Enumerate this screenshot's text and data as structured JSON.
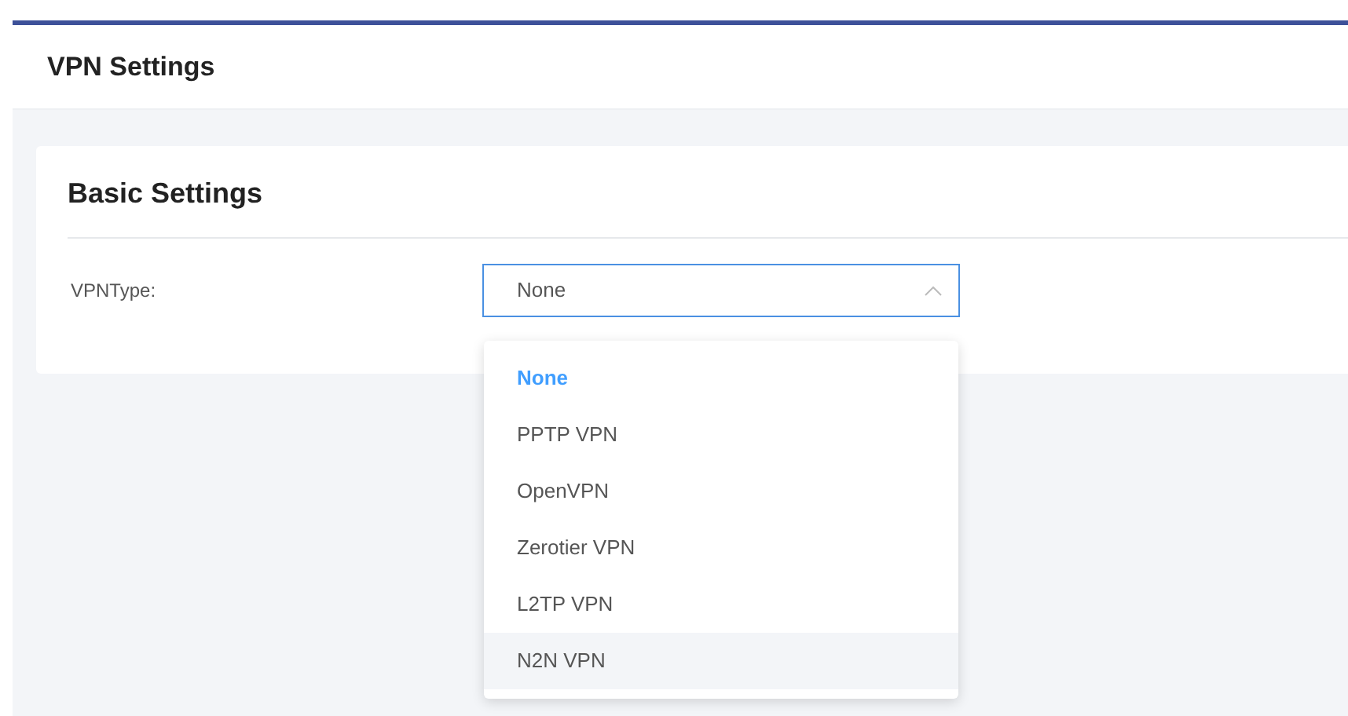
{
  "page_title": "VPN Settings",
  "card": {
    "title": "Basic Settings",
    "field": {
      "label": "VPNType:",
      "value": "None",
      "expanded": true,
      "options": [
        {
          "label": "None",
          "selected": true,
          "hovered": false
        },
        {
          "label": "PPTP VPN",
          "selected": false,
          "hovered": false
        },
        {
          "label": "OpenVPN",
          "selected": false,
          "hovered": false
        },
        {
          "label": "Zerotier VPN",
          "selected": false,
          "hovered": false
        },
        {
          "label": "L2TP VPN",
          "selected": false,
          "hovered": false
        },
        {
          "label": "N2N VPN",
          "selected": false,
          "hovered": true
        }
      ]
    }
  }
}
